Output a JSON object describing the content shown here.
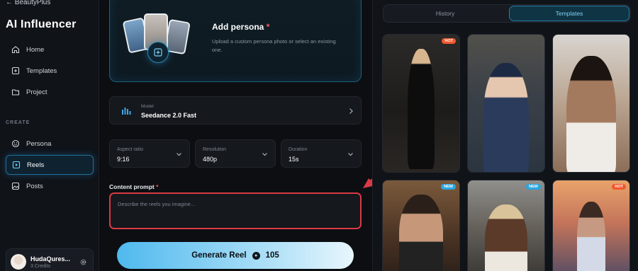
{
  "sidebar": {
    "back_label": "← BeautyPlus",
    "app_title": "AI Influencer",
    "nav": [
      {
        "label": "Home",
        "icon": "home-icon"
      },
      {
        "label": "Templates",
        "icon": "templates-icon"
      },
      {
        "label": "Project",
        "icon": "folder-icon"
      }
    ],
    "section_create": "CREATE",
    "create_items": [
      {
        "label": "Persona",
        "icon": "persona-icon"
      },
      {
        "label": "Reels",
        "icon": "reels-icon",
        "active": true
      },
      {
        "label": "Posts",
        "icon": "image-icon"
      }
    ],
    "user": {
      "name": "HudaQures...",
      "credits": "3 Credits"
    }
  },
  "main": {
    "persona": {
      "title": "Add persona",
      "required_mark": "*",
      "description": "Upload a custom persona photo or select an existing one."
    },
    "model": {
      "label": "Model",
      "value": "Seedance 2.0 Fast"
    },
    "aspect_ratio": {
      "label": "Aspect ratio",
      "value": "9:16"
    },
    "resolution": {
      "label": "Resolution",
      "value": "480p"
    },
    "duration": {
      "label": "Duration",
      "value": "15s"
    },
    "prompt": {
      "label": "Content prompt",
      "required_mark": "*",
      "placeholder": "Describe the reels you imagine..."
    },
    "generate": {
      "label": "Generate Reel",
      "cost": "105"
    }
  },
  "right": {
    "tabs": [
      {
        "label": "History",
        "active": false
      },
      {
        "label": "Templates",
        "active": true
      }
    ],
    "templates": [
      {
        "badge": "HOT"
      },
      {
        "badge": ""
      },
      {
        "badge": ""
      },
      {
        "badge": "NEW"
      },
      {
        "badge": "NEW"
      },
      {
        "badge": "HOT"
      }
    ]
  },
  "colors": {
    "accent": "#2a7ea6",
    "highlight_red": "#d93a45",
    "hot_badge": "#f0582e",
    "new_badge": "#2aa6e0"
  }
}
